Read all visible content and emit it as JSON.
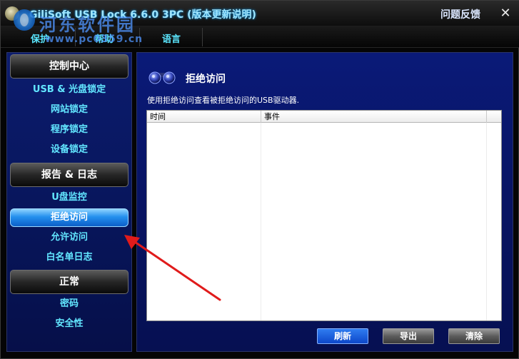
{
  "window": {
    "title": "GiliSoft USB Lock 6.6.0 3PC (版本更新说明)",
    "feedback": "问题反馈",
    "close_glyph": "✕"
  },
  "watermark": {
    "text": "河东软件园",
    "url": "www.pc0359.cn"
  },
  "menu": {
    "items": [
      "保护",
      "帮助",
      "语言"
    ]
  },
  "sidebar": {
    "sections": [
      {
        "label": "控制中心",
        "items": [
          "USB & 光盘锁定",
          "网站锁定",
          "程序锁定",
          "设备锁定"
        ]
      },
      {
        "label": "报告 & 日志",
        "items": [
          "U盘监控",
          "拒绝访问",
          "允许访问",
          "白名单日志"
        ]
      },
      {
        "label": "正常",
        "items": [
          "密码",
          "安全性"
        ]
      }
    ],
    "active_item": "拒绝访问"
  },
  "main": {
    "title": "拒绝访问",
    "description": "使用拒绝访问查看被拒绝访问的USB驱动器.",
    "table": {
      "columns": [
        "时间",
        "事件"
      ],
      "rows": []
    },
    "buttons": {
      "refresh": "刷新",
      "export": "导出",
      "clear": "清除"
    }
  },
  "colors": {
    "nav_text": "#62e6ff",
    "active_bg": "#2490ee",
    "content_bg": "#081463",
    "arrow": "#e01b1b"
  },
  "icons": {
    "app": "lock-globe-icon",
    "page": "binoculars-icon",
    "annotation": "red-arrow"
  }
}
